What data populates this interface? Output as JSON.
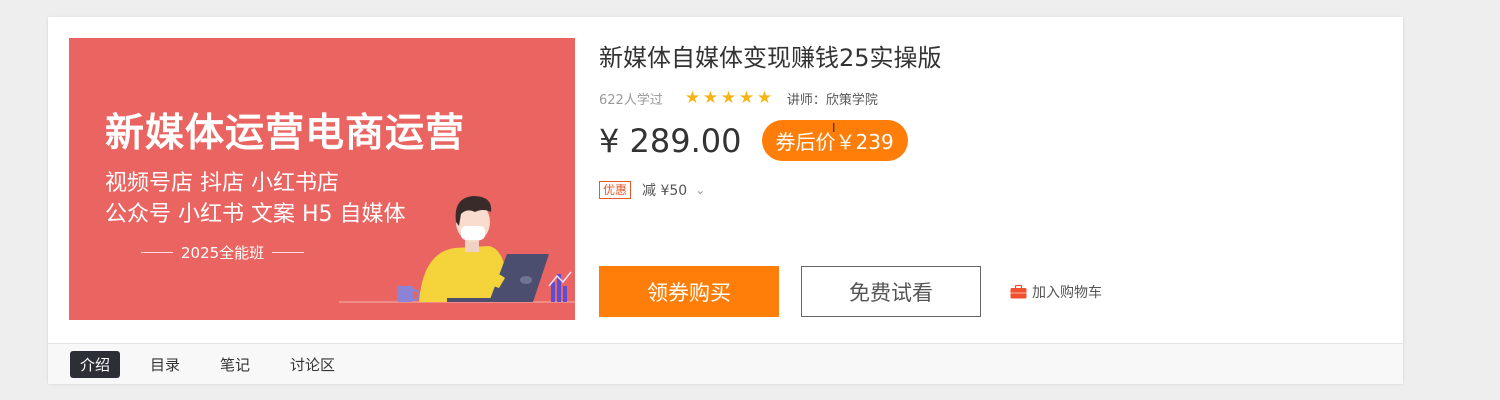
{
  "cover": {
    "headline": "新媒体运营电商运营",
    "line1": "视频号店  抖店   小红书店",
    "line2": "公众号 小红书 文案  H5  自媒体",
    "tag": "2025全能班",
    "background_color": "#ea6561"
  },
  "course": {
    "title": "新媒体自媒体变现赚钱25实操版",
    "learners": "622人学过",
    "rating_stars": 5,
    "teacher_label": "讲师：",
    "teacher_name": "欣策学院",
    "price": "¥ 289.00",
    "coupon_price": "券后价￥239",
    "promo_badge": "优惠",
    "promo_text": "减 ¥50"
  },
  "actions": {
    "buy_label": "领券购买",
    "trial_label": "免费试看",
    "cart_label": "加入购物车"
  },
  "tabs": [
    {
      "label": "介绍",
      "active": true
    },
    {
      "label": "目录",
      "active": false
    },
    {
      "label": "笔记",
      "active": false
    },
    {
      "label": "讨论区",
      "active": false
    }
  ],
  "colors": {
    "accent": "#fe7e09",
    "star": "#f5b615",
    "tab_active_bg": "#2c2f36",
    "promo_red": "#e8572b"
  },
  "icons": {
    "star": "star-icon",
    "chevron": "chevron-down-icon",
    "cart": "briefcase-cart-icon"
  }
}
